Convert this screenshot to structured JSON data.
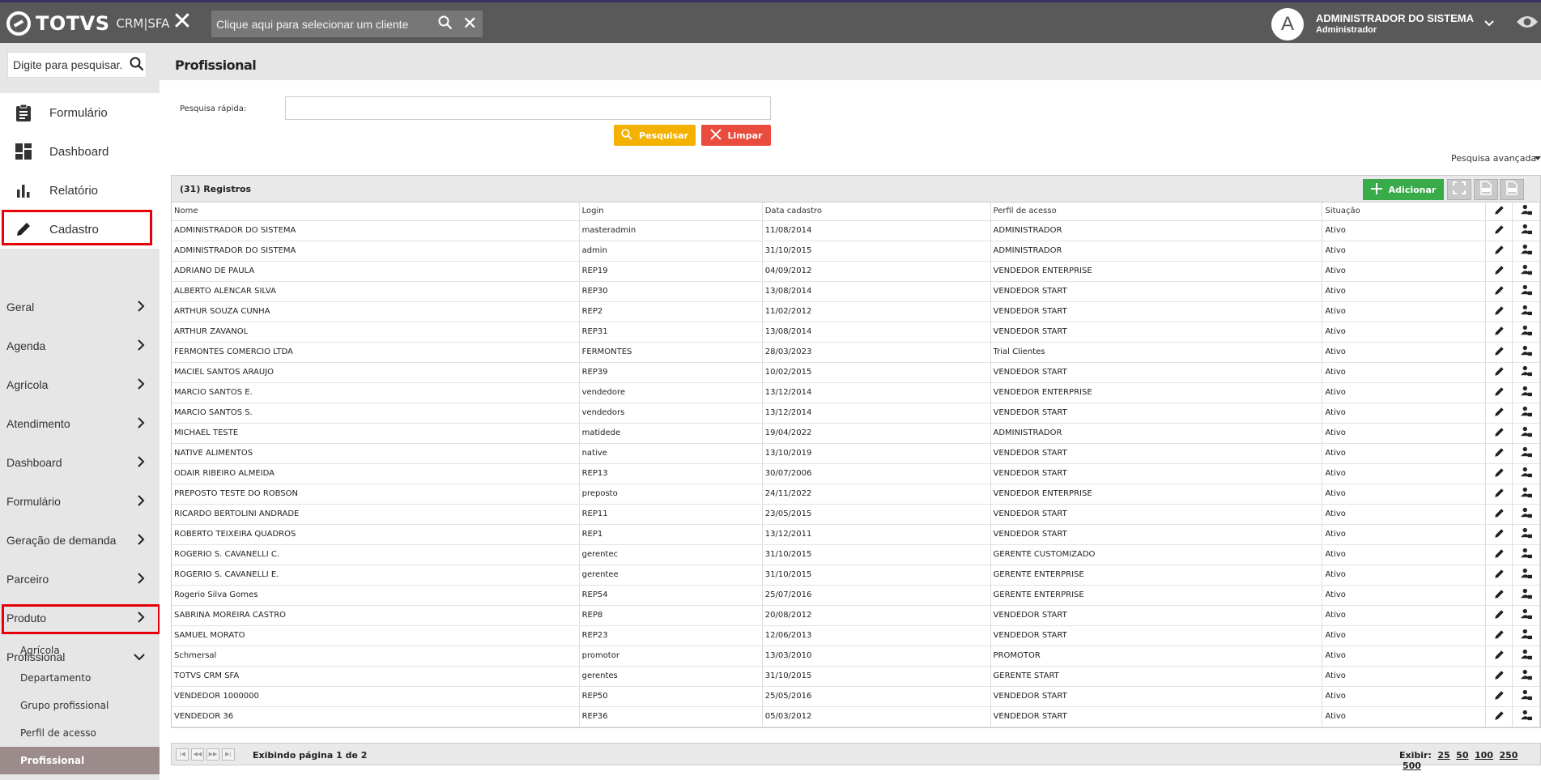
{
  "header": {
    "brand": "TOTVS",
    "brand_sub": "CRM|SFA",
    "client_search_placeholder": "Clique aqui para selecionar um cliente",
    "avatar_letter": "A",
    "user_name": "ADMINISTRADOR DO SISTEMA",
    "user_role": "Administrador"
  },
  "sidebar": {
    "search_placeholder": "Digite para pesquisar...",
    "main_items": [
      {
        "label": "Formulário",
        "icon": "clipboard-icon"
      },
      {
        "label": "Dashboard",
        "icon": "dashboard-icon"
      },
      {
        "label": "Relatório",
        "icon": "bar-chart-icon"
      },
      {
        "label": "Cadastro",
        "icon": "pencil-icon"
      }
    ],
    "sections": [
      "Geral",
      "Agenda",
      "Agrícola",
      "Atendimento",
      "Dashboard",
      "Formulário",
      "Geração de demanda",
      "Parceiro",
      "Produto",
      "Profissional"
    ],
    "sub_items": [
      "Agrícola",
      "Departamento",
      "Grupo profissional",
      "Perfil de acesso",
      "Profissional"
    ]
  },
  "page": {
    "title": "Profissional",
    "quick_search_label": "Pesquisa rápida:",
    "search_button": "Pesquisar",
    "clear_button": "Limpar",
    "advanced_search": "Pesquisa avançada"
  },
  "grid": {
    "records": "(31) Registros",
    "add_button": "Adicionar",
    "columns": [
      "Nome",
      "Login",
      "Data cadastro",
      "Perfil de acesso",
      "Situação"
    ],
    "rows": [
      [
        "ADMINISTRADOR DO SISTEMA",
        "masteradmin",
        "11/08/2014",
        "ADMINISTRADOR",
        "Ativo"
      ],
      [
        "ADMINISTRADOR DO SISTEMA",
        "admin",
        "31/10/2015",
        "ADMINISTRADOR",
        "Ativo"
      ],
      [
        "ADRIANO DE PAULA",
        "REP19",
        "04/09/2012",
        "VENDEDOR ENTERPRISE",
        "Ativo"
      ],
      [
        "ALBERTO ALENCAR SILVA",
        "REP30",
        "13/08/2014",
        "VENDEDOR START",
        "Ativo"
      ],
      [
        "ARTHUR SOUZA CUNHA",
        "REP2",
        "11/02/2012",
        "VENDEDOR START",
        "Ativo"
      ],
      [
        "ARTHUR ZAVANOL",
        "REP31",
        "13/08/2014",
        "VENDEDOR START",
        "Ativo"
      ],
      [
        "FERMONTES COMERCIO LTDA",
        "FERMONTES",
        "28/03/2023",
        "Trial Clientes",
        "Ativo"
      ],
      [
        "MACIEL SANTOS ARAUJO",
        "REP39",
        "10/02/2015",
        "VENDEDOR START",
        "Ativo"
      ],
      [
        "MARCIO SANTOS E.",
        "vendedore",
        "13/12/2014",
        "VENDEDOR ENTERPRISE",
        "Ativo"
      ],
      [
        "MARCIO SANTOS S.",
        "vendedors",
        "13/12/2014",
        "VENDEDOR START",
        "Ativo"
      ],
      [
        "MICHAEL TESTE",
        "matidede",
        "19/04/2022",
        "ADMINISTRADOR",
        "Ativo"
      ],
      [
        "NATIVE ALIMENTOS",
        "native",
        "13/10/2019",
        "VENDEDOR START",
        "Ativo"
      ],
      [
        "ODAIR RIBEIRO ALMEIDA",
        "REP13",
        "30/07/2006",
        "VENDEDOR START",
        "Ativo"
      ],
      [
        "PREPOSTO TESTE DO ROBSON",
        "preposto",
        "24/11/2022",
        "VENDEDOR ENTERPRISE",
        "Ativo"
      ],
      [
        "RICARDO BERTOLINI ANDRADE",
        "REP11",
        "23/05/2015",
        "VENDEDOR START",
        "Ativo"
      ],
      [
        "ROBERTO TEIXEIRA QUADROS",
        "REP1",
        "13/12/2011",
        "VENDEDOR START",
        "Ativo"
      ],
      [
        "ROGERIO S. CAVANELLI C.",
        "gerentec",
        "31/10/2015",
        "GERENTE CUSTOMIZADO",
        "Ativo"
      ],
      [
        "ROGERIO S. CAVANELLI E.",
        "gerentee",
        "31/10/2015",
        "GERENTE ENTERPRISE",
        "Ativo"
      ],
      [
        "Rogerio Silva Gomes",
        "REP54",
        "25/07/2016",
        "GERENTE ENTERPRISE",
        "Ativo"
      ],
      [
        "SABRINA MOREIRA CASTRO",
        "REP8",
        "20/08/2012",
        "VENDEDOR START",
        "Ativo"
      ],
      [
        "SAMUEL MORATO",
        "REP23",
        "12/06/2013",
        "VENDEDOR START",
        "Ativo"
      ],
      [
        "Schmersal",
        "promotor",
        "13/03/2010",
        "PROMOTOR",
        "Ativo"
      ],
      [
        "TOTVS CRM SFA",
        "gerentes",
        "31/10/2015",
        "GERENTE START",
        "Ativo"
      ],
      [
        "VENDEDOR 1000000",
        "REP50",
        "25/05/2016",
        "VENDEDOR START",
        "Ativo"
      ],
      [
        "VENDEDOR 36",
        "REP36",
        "05/03/2012",
        "VENDEDOR START",
        "Ativo"
      ]
    ]
  },
  "pager": {
    "info": "Exibindo página 1 de 2",
    "show_label": "Exibir:",
    "sizes": [
      "25",
      "50",
      "100",
      "250",
      "500"
    ]
  },
  "colors": {
    "topbar": "#595959",
    "accent_yellow": "#f5b100",
    "accent_red": "#e94b3c",
    "accent_green": "#3aab4a",
    "highlight_box": "#e5000a"
  }
}
